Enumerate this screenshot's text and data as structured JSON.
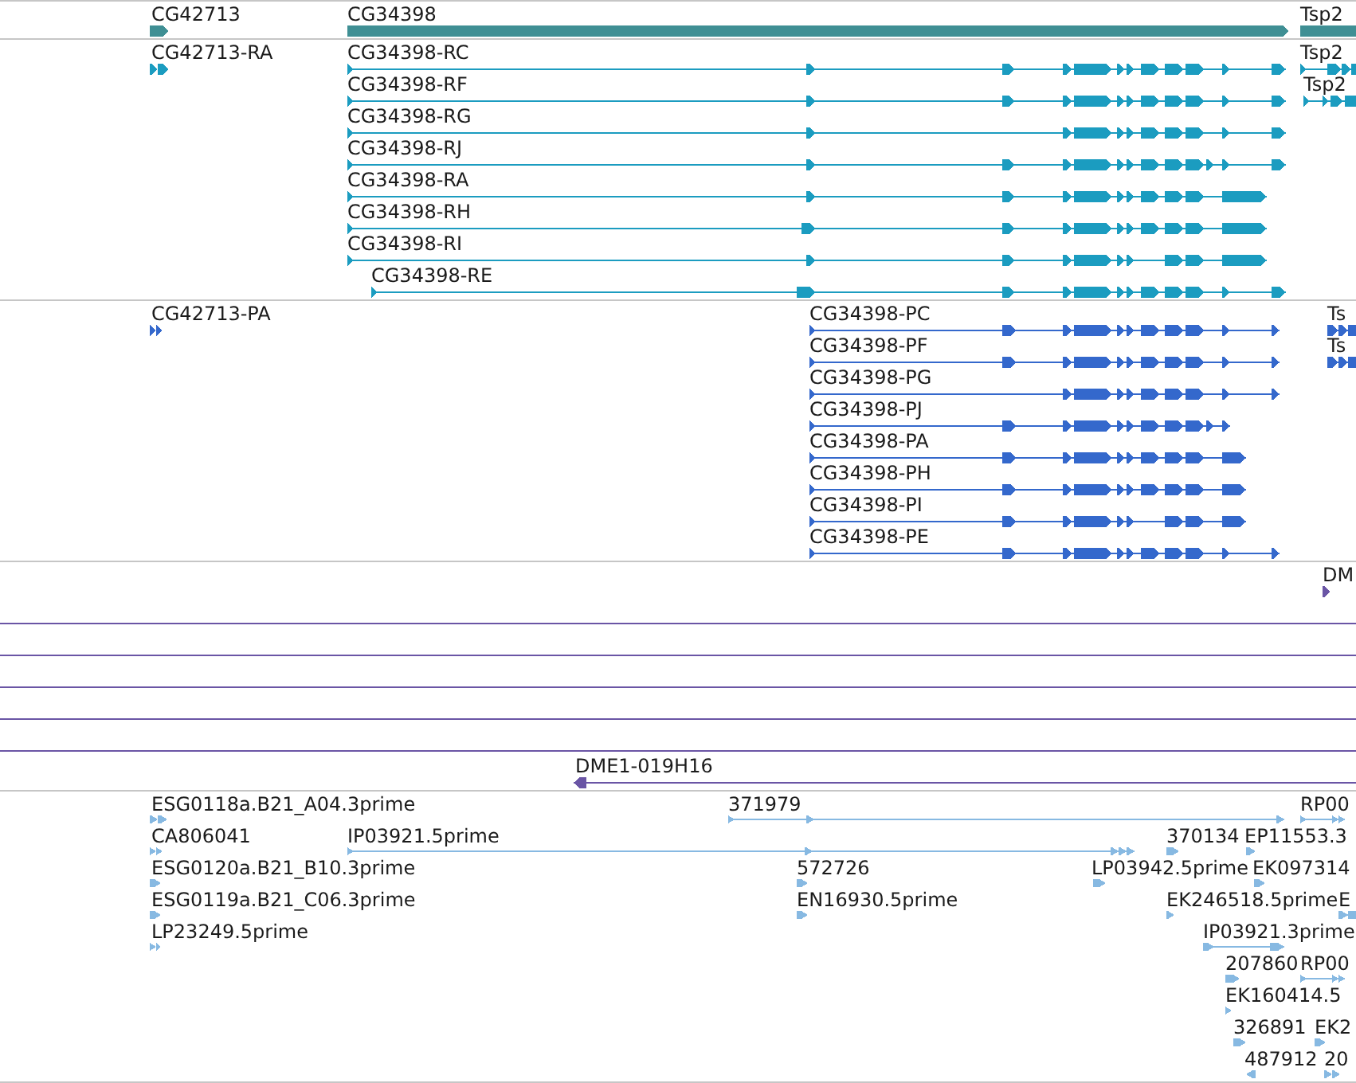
{
  "tracks": [
    {
      "kind": "gene",
      "features": [
        {
          "label": "CG42713"
        },
        {
          "label": "CG34398"
        },
        {
          "label": "Tsp2"
        }
      ]
    },
    {
      "kind": "mrna",
      "features": [
        {
          "label": "CG42713-RA"
        },
        {
          "label": "CG34398-RC"
        },
        {
          "label": "CG34398-RF"
        },
        {
          "label": "CG34398-RG"
        },
        {
          "label": "CG34398-RJ"
        },
        {
          "label": "CG34398-RA"
        },
        {
          "label": "CG34398-RH"
        },
        {
          "label": "CG34398-RI"
        },
        {
          "label": "CG34398-RE"
        },
        {
          "label": "Tsp2"
        },
        {
          "label": "Tsp2"
        }
      ]
    },
    {
      "kind": "protein",
      "features": [
        {
          "label": "CG42713-PA"
        },
        {
          "label": "CG34398-PC"
        },
        {
          "label": "CG34398-PF"
        },
        {
          "label": "CG34398-PG"
        },
        {
          "label": "CG34398-PJ"
        },
        {
          "label": "CG34398-PA"
        },
        {
          "label": "CG34398-PH"
        },
        {
          "label": "CG34398-PI"
        },
        {
          "label": "CG34398-PE"
        },
        {
          "label": "Ts"
        },
        {
          "label": "Ts"
        }
      ]
    },
    {
      "kind": "clone",
      "features": [
        {
          "label": "DM"
        },
        {
          "label": "DME1-019H16"
        }
      ]
    },
    {
      "kind": "est",
      "features": [
        {
          "label": "ESG0118a.B21_A04.3prime"
        },
        {
          "label": "371979"
        },
        {
          "label": "RP00"
        },
        {
          "label": "CA806041"
        },
        {
          "label": "IP03921.5prime"
        },
        {
          "label": "370134"
        },
        {
          "label": "EP11553.3"
        },
        {
          "label": "ESG0120a.B21_B10.3prime"
        },
        {
          "label": "572726"
        },
        {
          "label": "LP03942.5prime"
        },
        {
          "label": "EK097314"
        },
        {
          "label": "ESG0119a.B21_C06.3prime"
        },
        {
          "label": "EN16930.5prime"
        },
        {
          "label": "EK246518.5prime"
        },
        {
          "label": "E"
        },
        {
          "label": "LP23249.5prime"
        },
        {
          "label": "IP03921.3prime"
        },
        {
          "label": "207860"
        },
        {
          "label": "RP00"
        },
        {
          "label": "EK160414.5"
        },
        {
          "label": "326891"
        },
        {
          "label": "EK2"
        },
        {
          "label": "487912"
        },
        {
          "label": "20"
        }
      ]
    }
  ]
}
